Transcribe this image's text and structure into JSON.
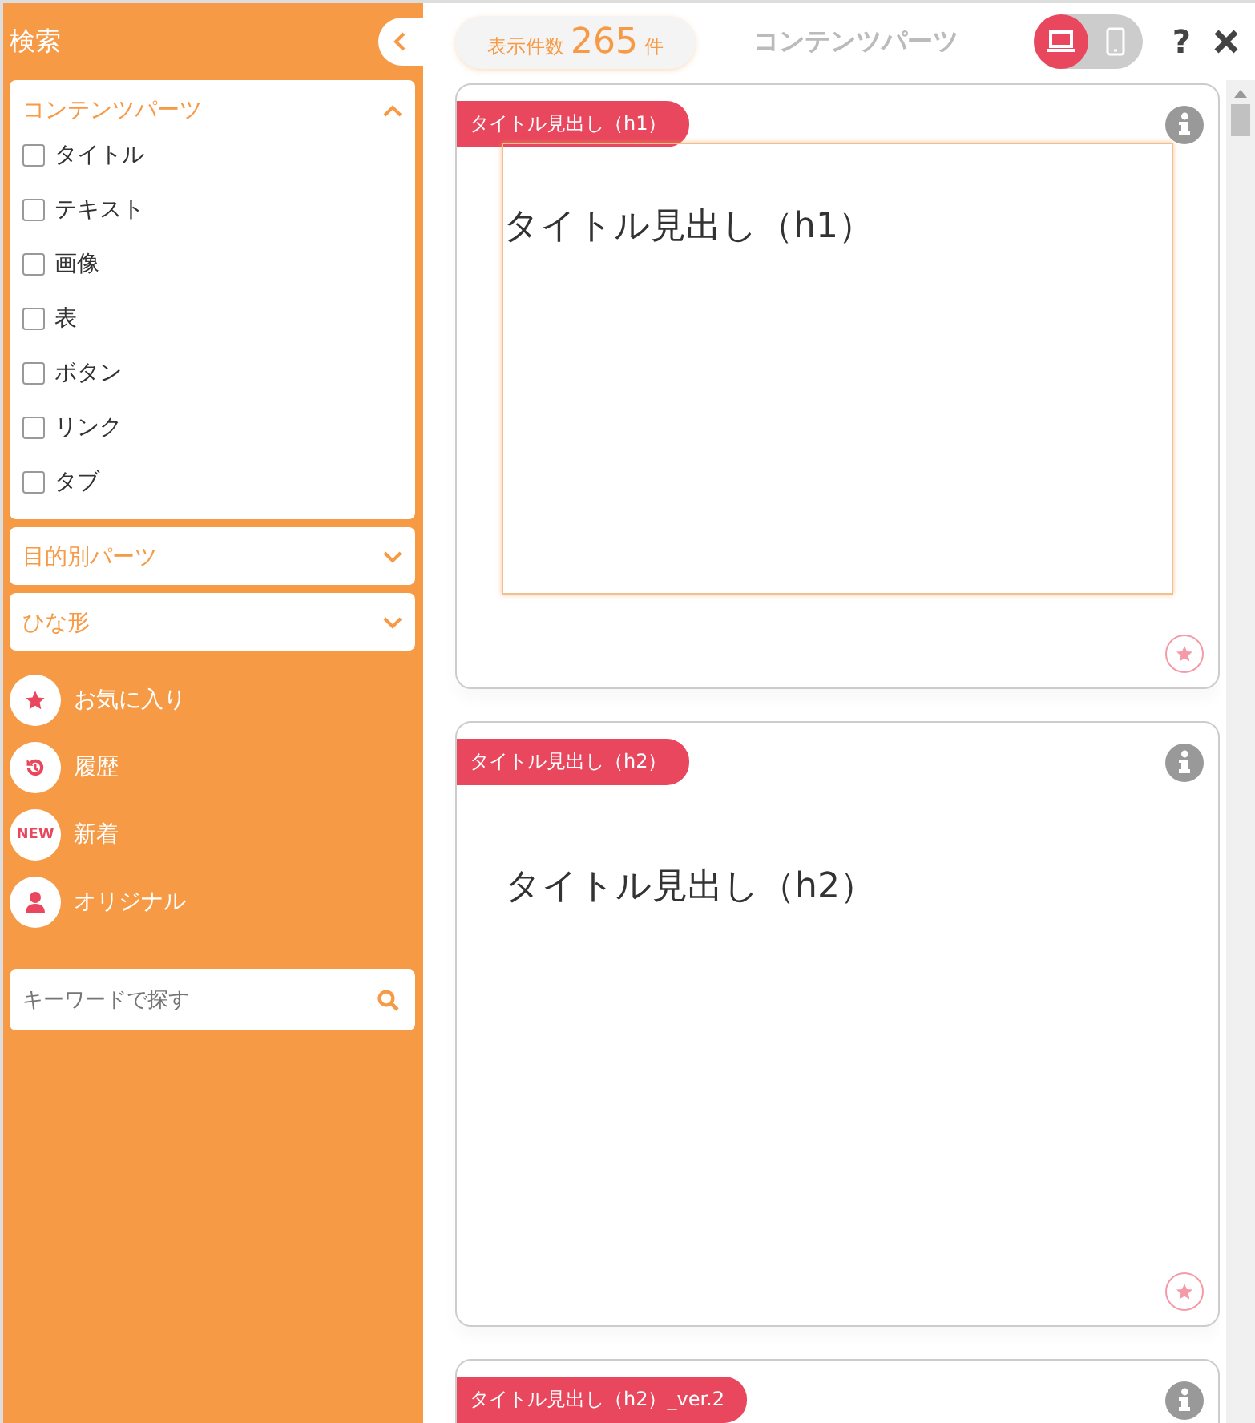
{
  "sidebar": {
    "title": "検索",
    "sections": [
      {
        "label": "コンテンツパーツ",
        "expanded": true,
        "options": [
          {
            "label": "タイトル",
            "checked": false
          },
          {
            "label": "テキスト",
            "checked": false
          },
          {
            "label": "画像",
            "checked": false
          },
          {
            "label": "表",
            "checked": false
          },
          {
            "label": "ボタン",
            "checked": false
          },
          {
            "label": "リンク",
            "checked": false
          },
          {
            "label": "タブ",
            "checked": false
          }
        ]
      },
      {
        "label": "目的別パーツ",
        "expanded": false
      },
      {
        "label": "ひな形",
        "expanded": false
      }
    ],
    "links": [
      {
        "kind": "star",
        "label": "お気に入り"
      },
      {
        "kind": "history",
        "label": "履歴"
      },
      {
        "kind": "new",
        "badge": "NEW",
        "label": "新着"
      },
      {
        "kind": "person",
        "label": "オリジナル"
      }
    ],
    "search": {
      "placeholder": "キーワードで探す"
    }
  },
  "header": {
    "count_label": "表示件数",
    "count": "265",
    "count_unit": "件",
    "title": "コンテンツパーツ",
    "devices": [
      {
        "kind": "desktop",
        "selected": true
      },
      {
        "kind": "mobile",
        "selected": false
      }
    ],
    "help": "?"
  },
  "cards": [
    {
      "tag": "タイトル見出し（h1）",
      "preview": "タイトル見出し（h1）",
      "framed": true
    },
    {
      "tag": "タイトル見出し（h2）",
      "preview": "タイトル見出し（h2）",
      "framed": false
    },
    {
      "tag": "タイトル見出し（h2）_ver.2"
    }
  ]
}
